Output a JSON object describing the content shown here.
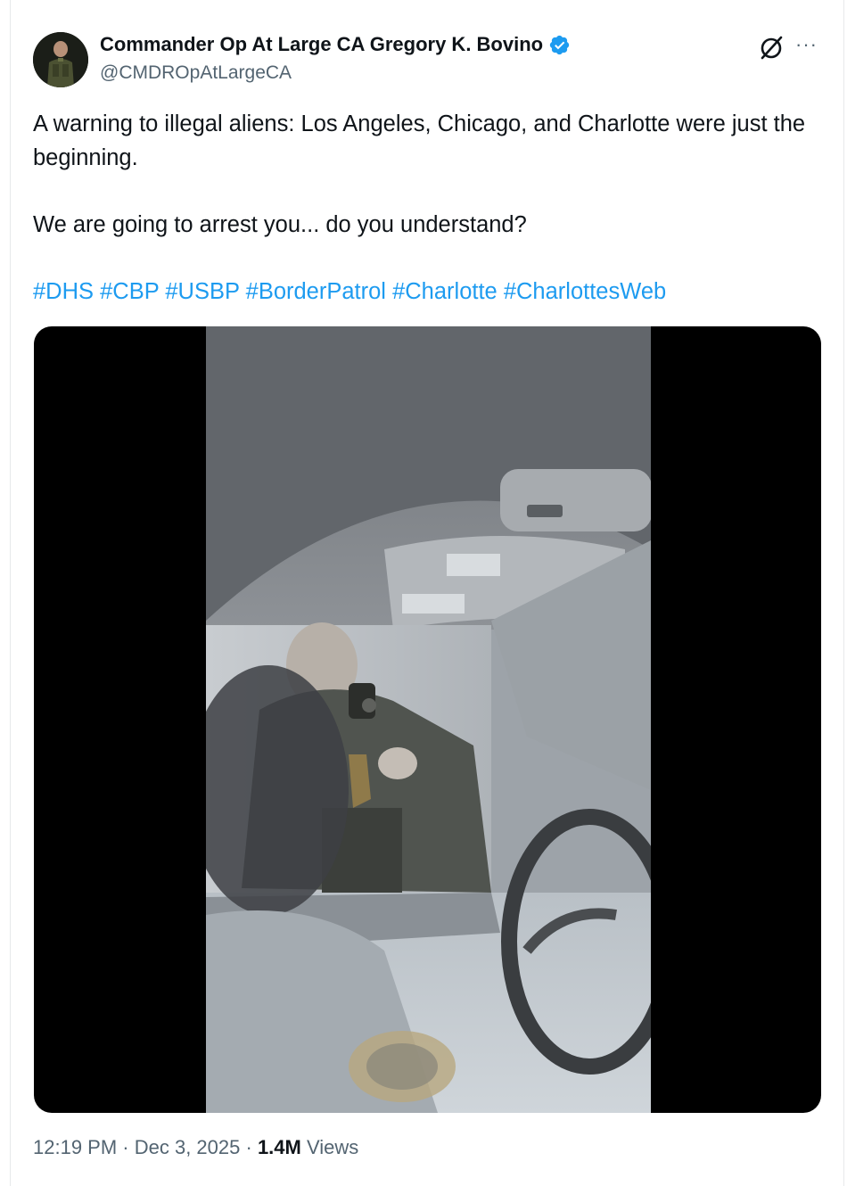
{
  "author": {
    "display_name": "Commander Op At Large CA Gregory K. Bovino",
    "handle": "@CMDROpAtLargeCA",
    "verified": true,
    "verified_color": "#1d9bf0"
  },
  "header_icons": {
    "grok": "grok-icon",
    "more": "more-options-icon",
    "more_glyph": "···"
  },
  "tweet": {
    "line1": "A warning to illegal aliens: Los Angeles, Chicago, and Charlotte were just the beginning.",
    "line2": "We are going to arrest you... do you understand?",
    "hashtags": [
      "#DHS",
      "#CBP",
      "#USBP",
      "#BorderPatrol",
      "#Charlotte",
      "#CharlottesWeb"
    ]
  },
  "media": {
    "type": "video",
    "description_icon": "video-thumbnail"
  },
  "footer": {
    "time": "12:19 PM",
    "separator1": " · ",
    "date": "Dec 3, 2025",
    "separator2": " · ",
    "views_count": "1.4M",
    "views_label": " Views"
  },
  "colors": {
    "link": "#1d9bf0",
    "secondary_text": "#536471",
    "primary_text": "#0f1419"
  }
}
